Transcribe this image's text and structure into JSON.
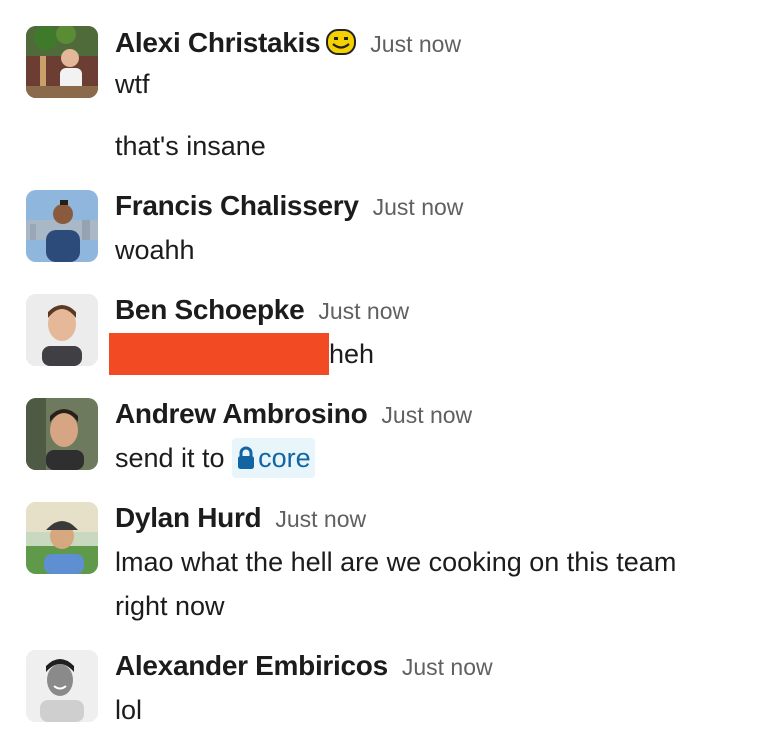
{
  "messages": [
    {
      "author": "Alexi Christakis",
      "status_emoji": "smile-face-emoji",
      "time": "Just now",
      "lines": [
        "wtf",
        "that's insane"
      ]
    },
    {
      "author": "Francis Chalissery",
      "time": "Just now",
      "lines": [
        "woahh"
      ]
    },
    {
      "author": "Ben Schoepke",
      "time": "Just now",
      "lines": [
        "heh"
      ]
    },
    {
      "author": "Andrew Ambrosino",
      "time": "Just now",
      "text_prefix": "send it to ",
      "channel": "core",
      "channel_icon": "lock-icon"
    },
    {
      "author": "Dylan Hurd",
      "time": "Just now",
      "lines": [
        "lmao what the hell are we cooking on this team",
        "right now"
      ]
    },
    {
      "author": "Alexander Embiricos",
      "time": "Just now",
      "lines": [
        "lol"
      ]
    }
  ],
  "colors": {
    "name": "#1d1c1d",
    "time": "#616061",
    "channel_text": "#1264a3",
    "channel_bg": "#e8f5fa",
    "redaction": "#f24a22"
  }
}
